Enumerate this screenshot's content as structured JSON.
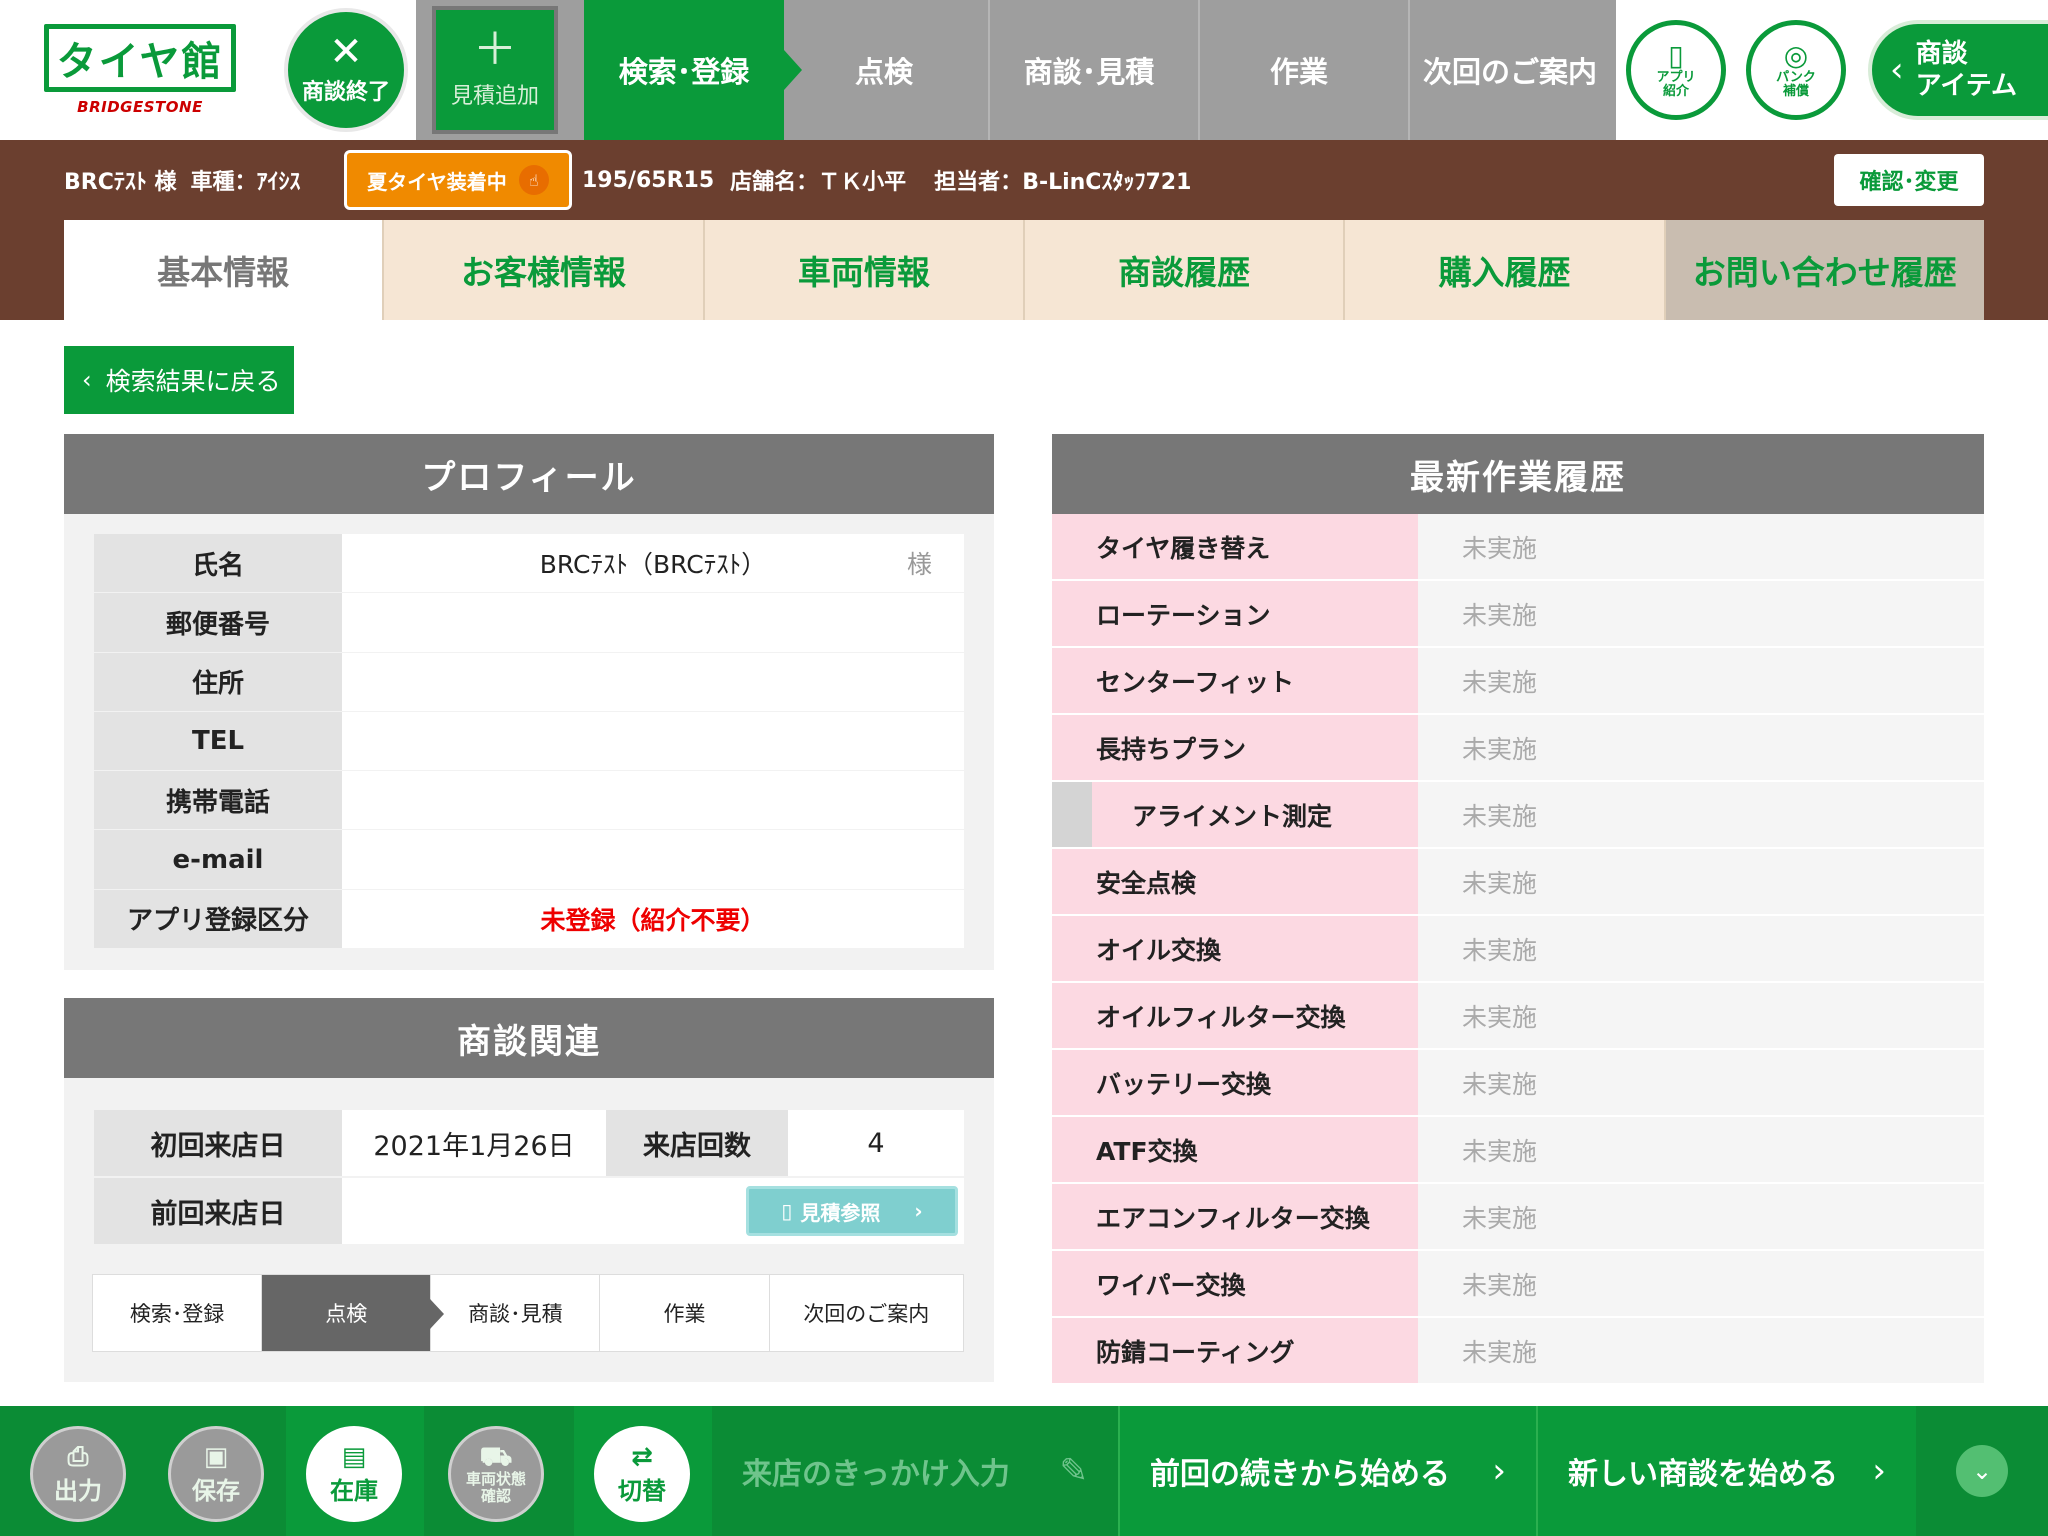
{
  "header": {
    "logo_text": "タイヤ館",
    "logo_sub": "BRIDGESTONE",
    "end_button": "商談終了",
    "add_estimate": "見積追加",
    "steps": [
      "検索･登録",
      "点検",
      "商談･見積",
      "作業",
      "次回のご案内"
    ],
    "active_step": 0,
    "app_intro": [
      "アプリ",
      "紹介"
    ],
    "puncture": [
      "パンク",
      "補償"
    ],
    "items_button": [
      "商談",
      "アイテム"
    ]
  },
  "customer_bar": {
    "customer": "BRCﾃｽﾄ 様",
    "car_label": "車種：",
    "car": "ｱｲｼｽ",
    "tire_status": "夏タイヤ装着中",
    "tire_size": "195/65R15",
    "store_label": "店舗名：",
    "store": "ＴＫ小平",
    "staff_label": "担当者：",
    "staff": "B-LinCｽﾀｯﾌ721",
    "confirm_button": "確認･変更"
  },
  "tabs": [
    "基本情報",
    "お客様情報",
    "車両情報",
    "商談履歴",
    "購入履歴",
    "お問い合わせ履歴"
  ],
  "back_button": "検索結果に戻る",
  "profile": {
    "title": "プロフィール",
    "rows": [
      {
        "label": "氏名",
        "value": "BRCﾃｽﾄ（BRCﾃｽﾄ）",
        "suffix": "様"
      },
      {
        "label": "郵便番号",
        "value": ""
      },
      {
        "label": "住所",
        "value": ""
      },
      {
        "label": "TEL",
        "value": ""
      },
      {
        "label": "携帯電話",
        "value": ""
      },
      {
        "label": "e-mail",
        "value": ""
      },
      {
        "label": "アプリ登録区分",
        "value": "未登録（紹介不要）"
      }
    ]
  },
  "negotiation": {
    "title": "商談関連",
    "first_visit_label": "初回来店日",
    "first_visit": "2021年1月26日",
    "visit_count_label": "来店回数",
    "visit_count": "4",
    "last_visit_label": "前回来店日",
    "last_visit": "",
    "estimate_button": "見積参照",
    "flow": [
      "検索･登録",
      "点検",
      "商談･見積",
      "作業",
      "次回のご案内"
    ],
    "flow_active": 1
  },
  "work_history": {
    "title": "最新作業履歴",
    "items": [
      {
        "label": "タイヤ履き替え",
        "status": "未実施"
      },
      {
        "label": "ローテーション",
        "status": "未実施"
      },
      {
        "label": "センターフィット",
        "status": "未実施"
      },
      {
        "label": "長持ちプラン",
        "status": "未実施"
      },
      {
        "label": "アライメント測定",
        "status": "未実施"
      },
      {
        "label": "安全点検",
        "status": "未実施"
      },
      {
        "label": "オイル交換",
        "status": "未実施"
      },
      {
        "label": "オイルフィルター交換",
        "status": "未実施"
      },
      {
        "label": "バッテリー交換",
        "status": "未実施"
      },
      {
        "label": "ATF交換",
        "status": "未実施"
      },
      {
        "label": "エアコンフィルター交換",
        "status": "未実施"
      },
      {
        "label": "ワイパー交換",
        "status": "未実施"
      },
      {
        "label": "防錆コーティング",
        "status": "未実施"
      }
    ]
  },
  "footer": {
    "output": "出力",
    "save": "保存",
    "stock": "在庫",
    "vehicle_check": [
      "車両状態",
      "確認"
    ],
    "switch": "切替",
    "visit_reason": "来店のきっかけ入力",
    "continue": "前回の続きから始める",
    "new_negotiation": "新しい商談を始める"
  },
  "colors": {
    "brand_green": "#0a9a3a",
    "brown": "#6b3f2f",
    "orange": "#f08a00",
    "pink": "#fcd9e2"
  }
}
